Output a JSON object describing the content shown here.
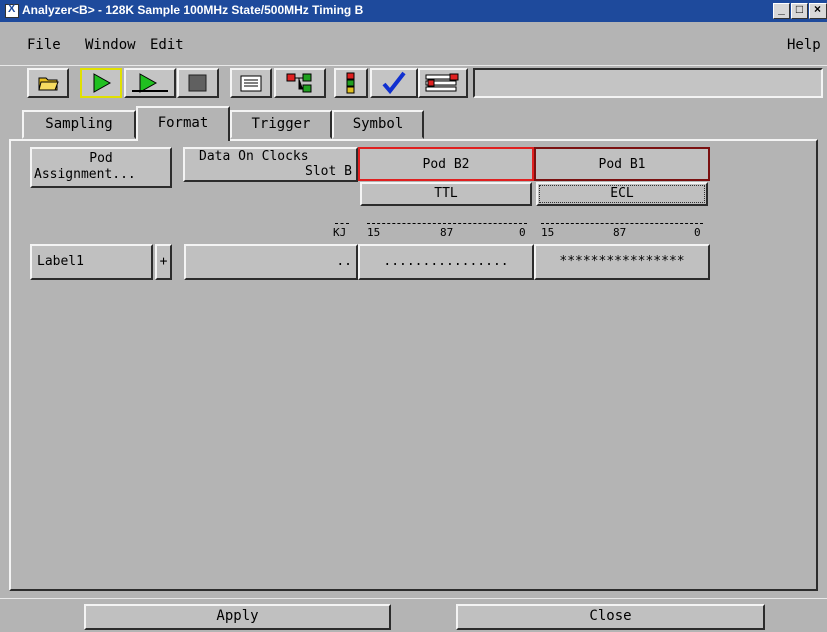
{
  "window": {
    "title": "Analyzer<B> - 128K Sample 100MHz State/500MHz Timing B",
    "controls": {
      "minimize": "_",
      "maximize": "□",
      "close": "×"
    }
  },
  "menu": {
    "file": "File",
    "window": "Window",
    "edit": "Edit",
    "help": "Help"
  },
  "toolbar": {
    "buttons": [
      "open-folder-icon",
      "run-single-icon",
      "run-repetitive-icon",
      "stop-icon",
      "listing-icon",
      "chart-icon",
      "waveform-icon",
      "checkmark-icon",
      "tools-icon"
    ],
    "status_text": ""
  },
  "tabs": [
    {
      "label": "Sampling",
      "selected": false
    },
    {
      "label": "Format",
      "selected": true
    },
    {
      "label": "Trigger",
      "selected": false
    },
    {
      "label": "Symbol",
      "selected": false
    }
  ],
  "format": {
    "pod_assignment_line1": "Pod",
    "pod_assignment_line2": "Assignment...",
    "data_on_clocks_line1": "Data On Clocks",
    "data_on_clocks_line2": "Slot B",
    "pods": [
      {
        "name": "Pod B2",
        "threshold": "TTL",
        "bits_high": "15",
        "bits_mid": "87",
        "bits_low": "0",
        "assignment": "................"
      },
      {
        "name": "Pod B1",
        "threshold": "ECL",
        "bits_high": "15",
        "bits_mid": "87",
        "bits_low": "0",
        "assignment": "****************"
      }
    ],
    "clock_bits": "KJ",
    "label_name": "Label1",
    "label_plus": "+",
    "clock_assignment": ".."
  },
  "bottom": {
    "apply": "Apply",
    "close": "Close"
  },
  "colors": {
    "titlebar": "#1e4a9c",
    "pod_b2_border": "#e02020",
    "pod_b1_border": "#7a1010",
    "toolbar_active": "#e0e000"
  }
}
